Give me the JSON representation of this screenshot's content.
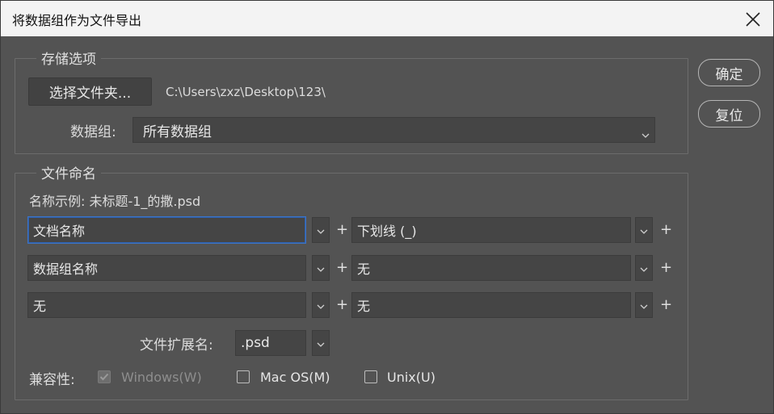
{
  "window": {
    "title": "将数据组作为文件导出"
  },
  "storage": {
    "legend": "存储选项",
    "choose_folder_label": "选择文件夹...",
    "path": "C:\\Users\\zxz\\Desktop\\123\\",
    "datagroup_label": "数据组:",
    "datagroup_value": "所有数据组"
  },
  "actions": {
    "ok_label": "确定",
    "reset_label": "复位"
  },
  "naming": {
    "legend": "文件命名",
    "example": "名称示例: 未标题-1_的撒.psd",
    "rows": [
      {
        "left": "文档名称",
        "right": "下划线 (_)"
      },
      {
        "left": "数据组名称",
        "right": "无"
      },
      {
        "left": "无",
        "right": "无"
      }
    ],
    "plus": "+",
    "ext_label": "文件扩展名:",
    "ext_value": ".psd",
    "compat_label": "兼容性:",
    "compat": [
      {
        "label": "Windows(W)",
        "checked": true,
        "disabled": true
      },
      {
        "label": "Mac OS(M)",
        "checked": false,
        "disabled": false
      },
      {
        "label": "Unix(U)",
        "checked": false,
        "disabled": false
      }
    ]
  }
}
